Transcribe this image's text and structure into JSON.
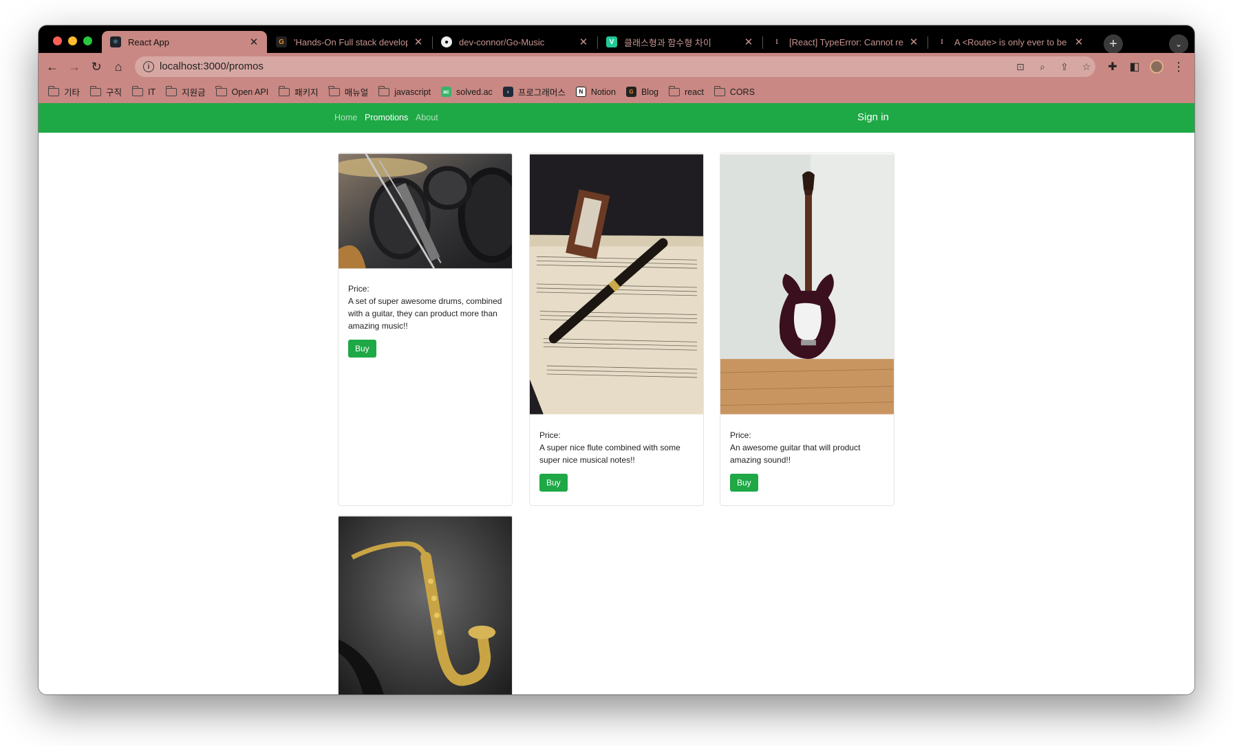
{
  "browser": {
    "tabs": [
      {
        "title": "React App",
        "active": true
      },
      {
        "title": "'Hands-On Full stack developm",
        "active": false
      },
      {
        "title": "dev-connor/Go-Music",
        "active": false
      },
      {
        "title": "클래스형과 함수형 차이",
        "active": false
      },
      {
        "title": "[React] TypeError: Cannot read",
        "active": false
      },
      {
        "title": "A <Route> is only ever to be us",
        "active": false
      }
    ],
    "url": "localhost:3000/promos",
    "bookmarks": [
      {
        "label": "기타",
        "icon": "folder-icon"
      },
      {
        "label": "구직",
        "icon": "folder-icon"
      },
      {
        "label": "IT",
        "icon": "folder-icon"
      },
      {
        "label": "지원금",
        "icon": "folder-icon"
      },
      {
        "label": "Open API",
        "icon": "folder-icon"
      },
      {
        "label": "패키지",
        "icon": "folder-icon"
      },
      {
        "label": "매뉴얼",
        "icon": "folder-icon"
      },
      {
        "label": "javascript",
        "icon": "folder-icon"
      },
      {
        "label": "solved.ac",
        "icon": "solvedac-icon"
      },
      {
        "label": "프로그래머스",
        "icon": "programmers-icon"
      },
      {
        "label": "Notion",
        "icon": "notion-icon"
      },
      {
        "label": "Blog",
        "icon": "blog-icon"
      },
      {
        "label": "react",
        "icon": "folder-icon"
      },
      {
        "label": "CORS",
        "icon": "folder-icon"
      }
    ],
    "colors": {
      "frame": "#c98883",
      "tabstrip": "#000000"
    }
  },
  "app": {
    "nav": {
      "home": "Home",
      "promotions": "Promotions",
      "about": "About",
      "signin": "Sign in"
    },
    "accent": "#1ea846",
    "products": [
      {
        "image": "drums-and-guitar-photo",
        "price_label": "Price:",
        "description": "A set of super awesome drums, combined with a guitar, they can product more than amazing music!!",
        "button": "Buy"
      },
      {
        "image": "flute-and-sheet-music-photo",
        "price_label": "Price:",
        "description": "A super nice flute combined with some super nice musical notes!!",
        "button": "Buy"
      },
      {
        "image": "electric-guitar-photo",
        "price_label": "Price:",
        "description": "An awesome guitar that will product amazing sound!!",
        "button": "Buy"
      },
      {
        "image": "saxophone-photo"
      }
    ]
  }
}
